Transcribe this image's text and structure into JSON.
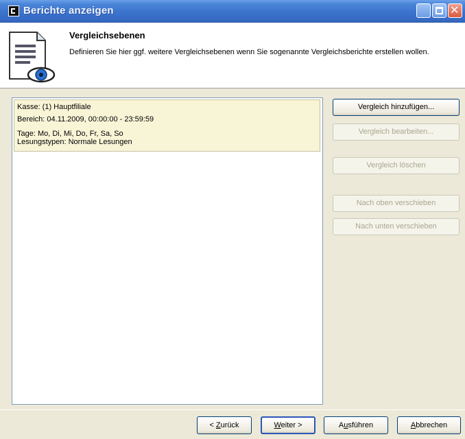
{
  "window": {
    "title": "Berichte anzeigen"
  },
  "header": {
    "title": "Vergleichsebenen",
    "description": "Definieren Sie hier ggf. weitere Vergleichsebenen wenn Sie sogenannte Vergleichsberichte erstellen wollen."
  },
  "list": {
    "items": [
      {
        "kasse": "Kasse: (1) Hauptfiliale",
        "bereich": "Bereich: 04.11.2009, 00:00:00 - 23:59:59",
        "tage": "Tage: Mo, Di, Mi, Do, Fr, Sa, So",
        "lesungstypen": "Lesungstypen: Normale Lesungen"
      }
    ]
  },
  "buttons": {
    "add": "Vergleich hinzufügen...",
    "edit": "Vergleich bearbeiten...",
    "delete": "Vergleich löschen",
    "move_up": "Nach oben verschieben",
    "move_down": "Nach unten verschieben"
  },
  "footer": {
    "back_prefix": "< ",
    "back_key": "Z",
    "back_rest": "urück",
    "next_key": "W",
    "next_rest": "eiter >",
    "run_first": "A",
    "run_key": "u",
    "run_rest": "sführen",
    "cancel_key": "A",
    "cancel_rest": "bbrechen"
  }
}
